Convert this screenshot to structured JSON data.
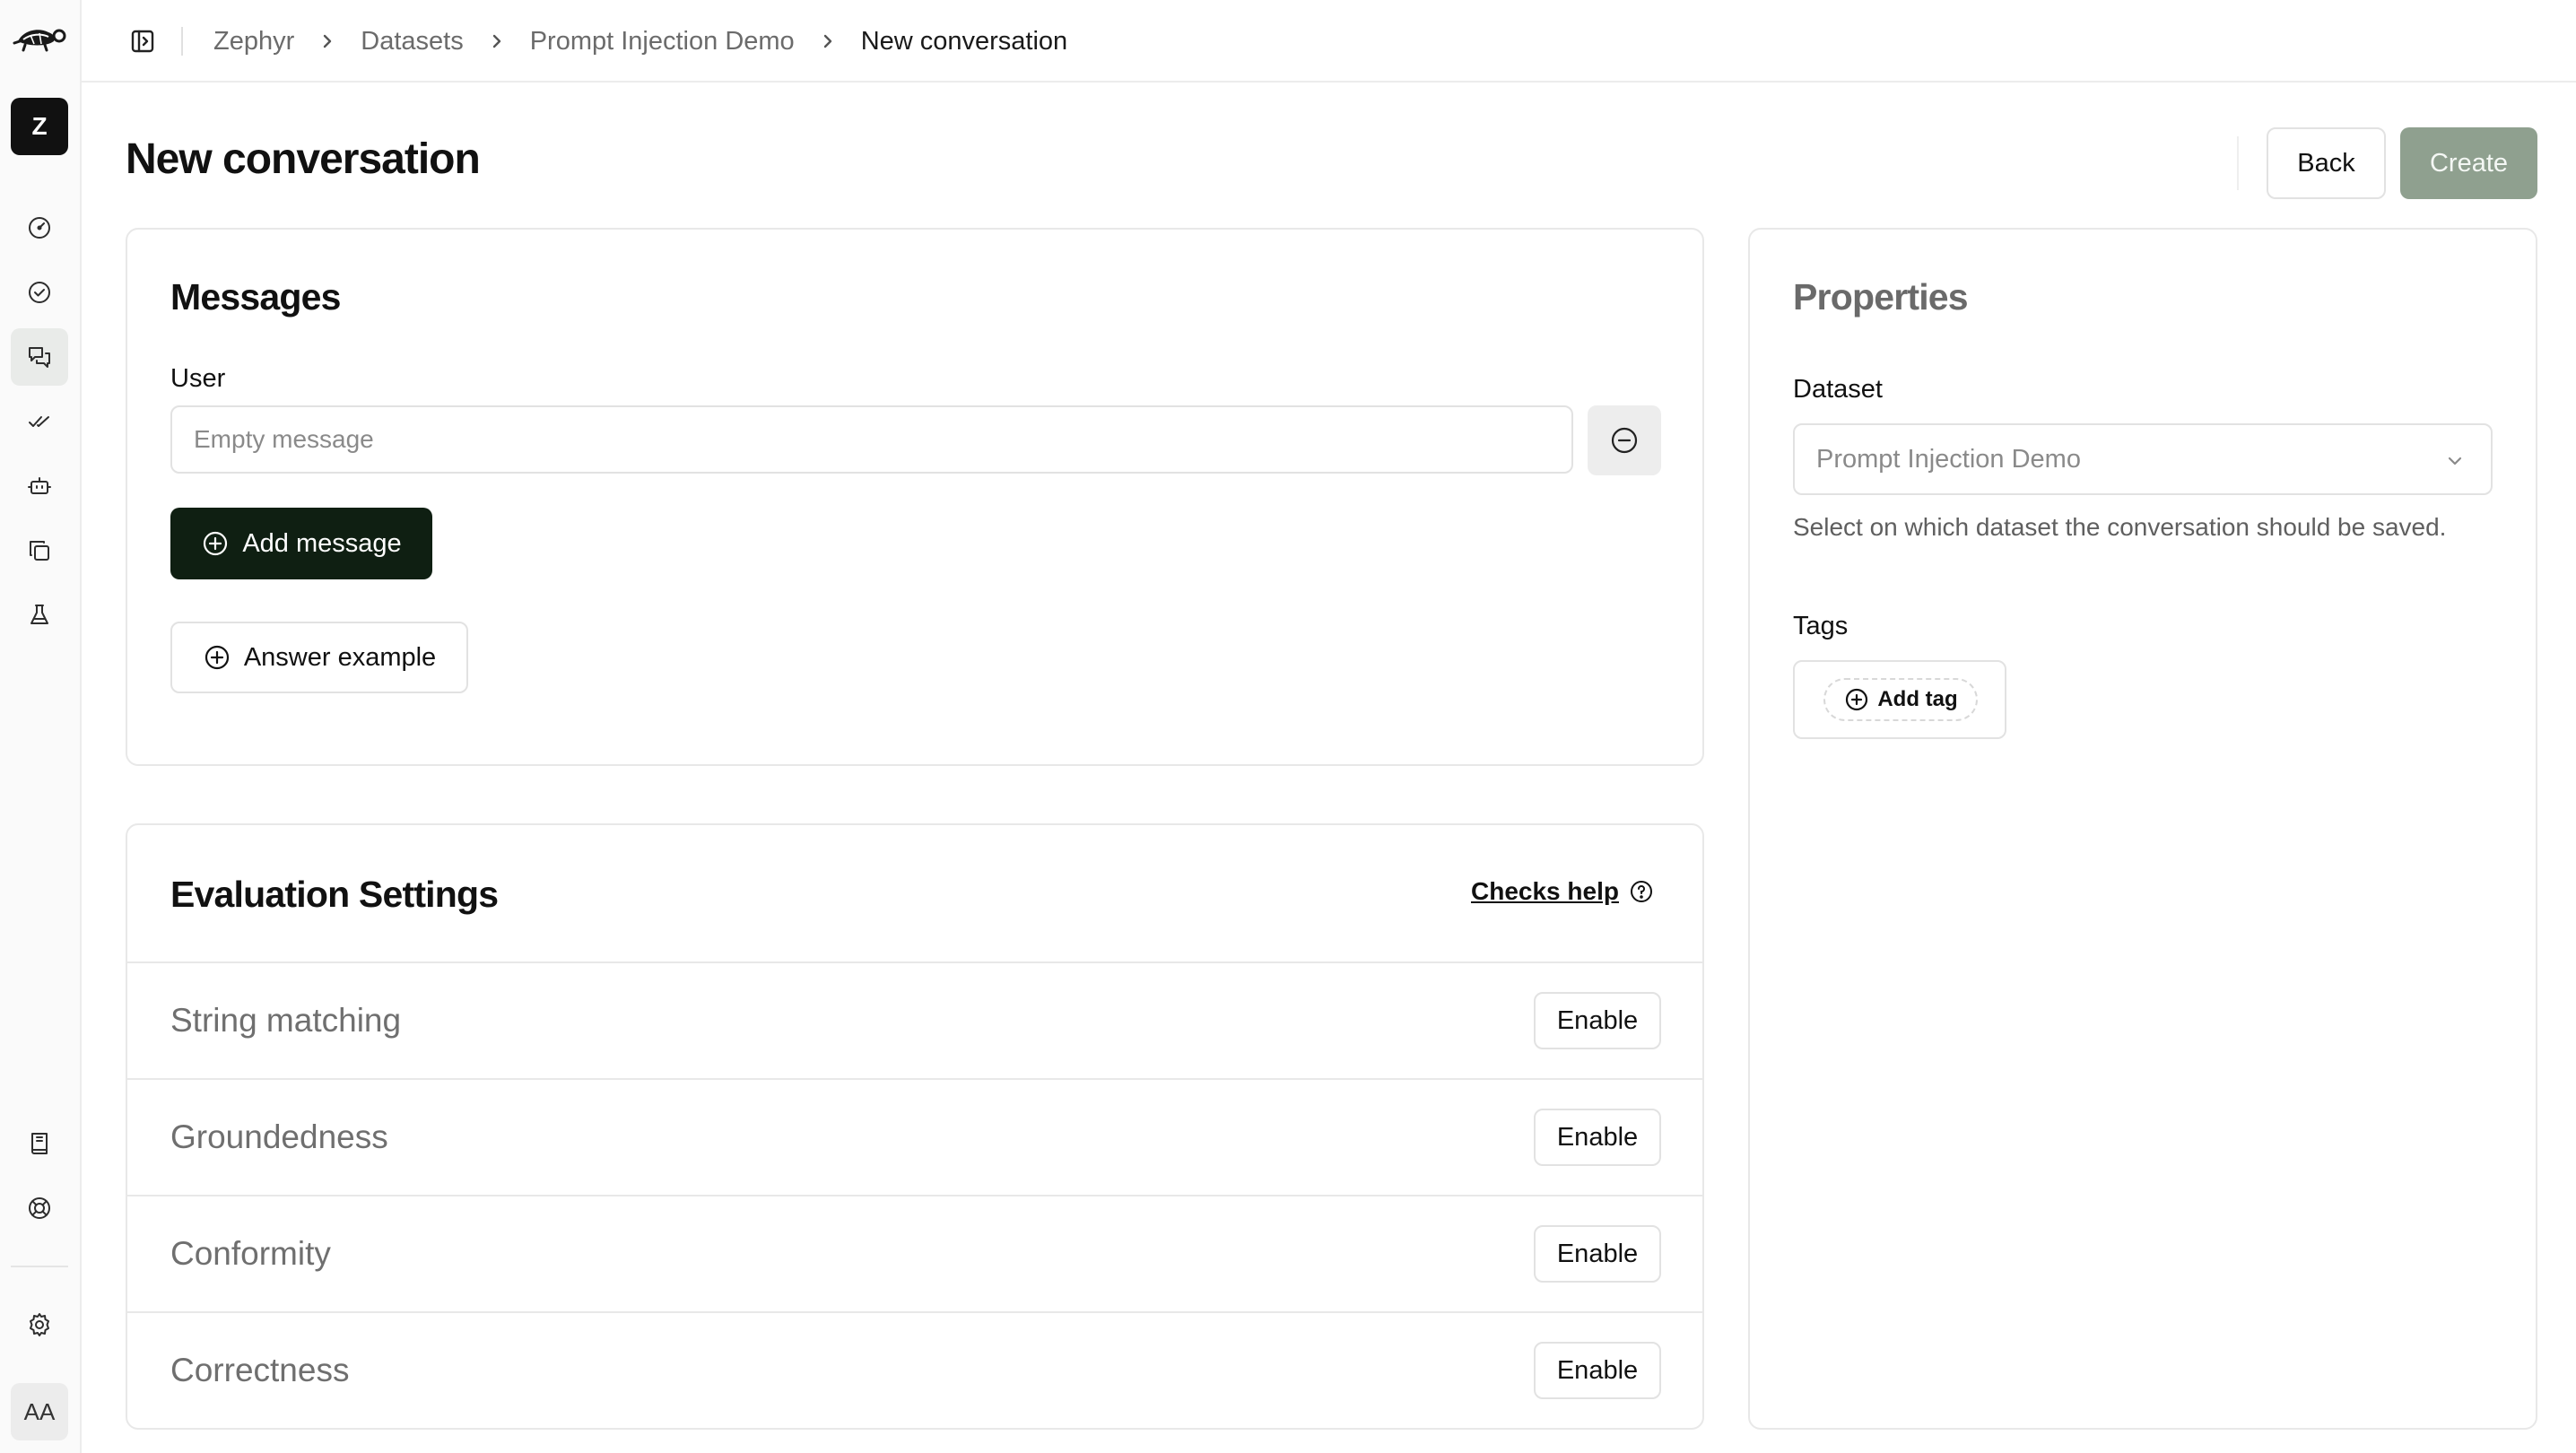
{
  "app": {
    "workspace_initial": "Z",
    "user_initials": "AA"
  },
  "breadcrumb": [
    "Zephyr",
    "Datasets",
    "Prompt Injection Demo",
    "New conversation"
  ],
  "sidebar": {
    "items": [
      {
        "icon": "gauge-icon",
        "active": false
      },
      {
        "icon": "check-circle-icon",
        "active": false
      },
      {
        "icon": "conversations-icon",
        "active": true
      },
      {
        "icon": "check-check-icon",
        "active": false
      },
      {
        "icon": "bot-icon",
        "active": false
      },
      {
        "icon": "copy-icon",
        "active": false
      },
      {
        "icon": "flask-icon",
        "active": false
      }
    ],
    "bottom_items": [
      {
        "icon": "book-icon"
      },
      {
        "icon": "lifebuoy-icon"
      },
      {
        "icon": "gear-icon"
      }
    ]
  },
  "header": {
    "title": "New conversation",
    "back_label": "Back",
    "create_label": "Create"
  },
  "messages": {
    "title": "Messages",
    "items": [
      {
        "role": "User",
        "value": "",
        "placeholder": "Empty message"
      }
    ],
    "add_message_label": "Add message",
    "answer_example_label": "Answer example"
  },
  "evaluation": {
    "title": "Evaluation Settings",
    "help_label": "Checks help",
    "checks": [
      {
        "name": "String matching",
        "action": "Enable"
      },
      {
        "name": "Groundedness",
        "action": "Enable"
      },
      {
        "name": "Conformity",
        "action": "Enable"
      },
      {
        "name": "Correctness",
        "action": "Enable"
      }
    ]
  },
  "properties": {
    "title": "Properties",
    "dataset_label": "Dataset",
    "dataset_value": "Prompt Injection Demo",
    "dataset_help": "Select on which dataset the conversation should be saved.",
    "tags_label": "Tags",
    "add_tag_label": "Add tag"
  },
  "colors": {
    "primary_dark": "#0f1f12",
    "create_disabled": "#8fa08f"
  }
}
